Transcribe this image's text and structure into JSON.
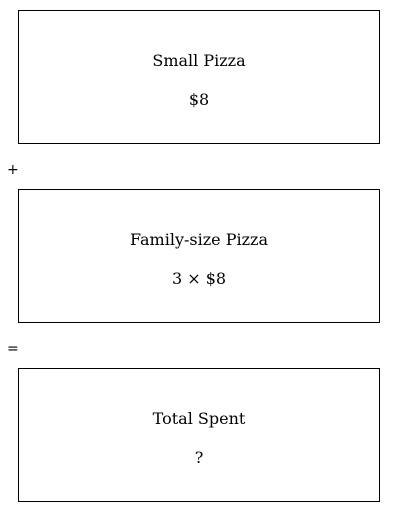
{
  "boxes": [
    {
      "title": "Small Pizza",
      "value": "$8"
    },
    {
      "title": "Family-size Pizza",
      "value": "3 × $8"
    },
    {
      "title": "Total Spent",
      "value": "?"
    }
  ],
  "operators": {
    "plus": "+",
    "equals": "="
  }
}
